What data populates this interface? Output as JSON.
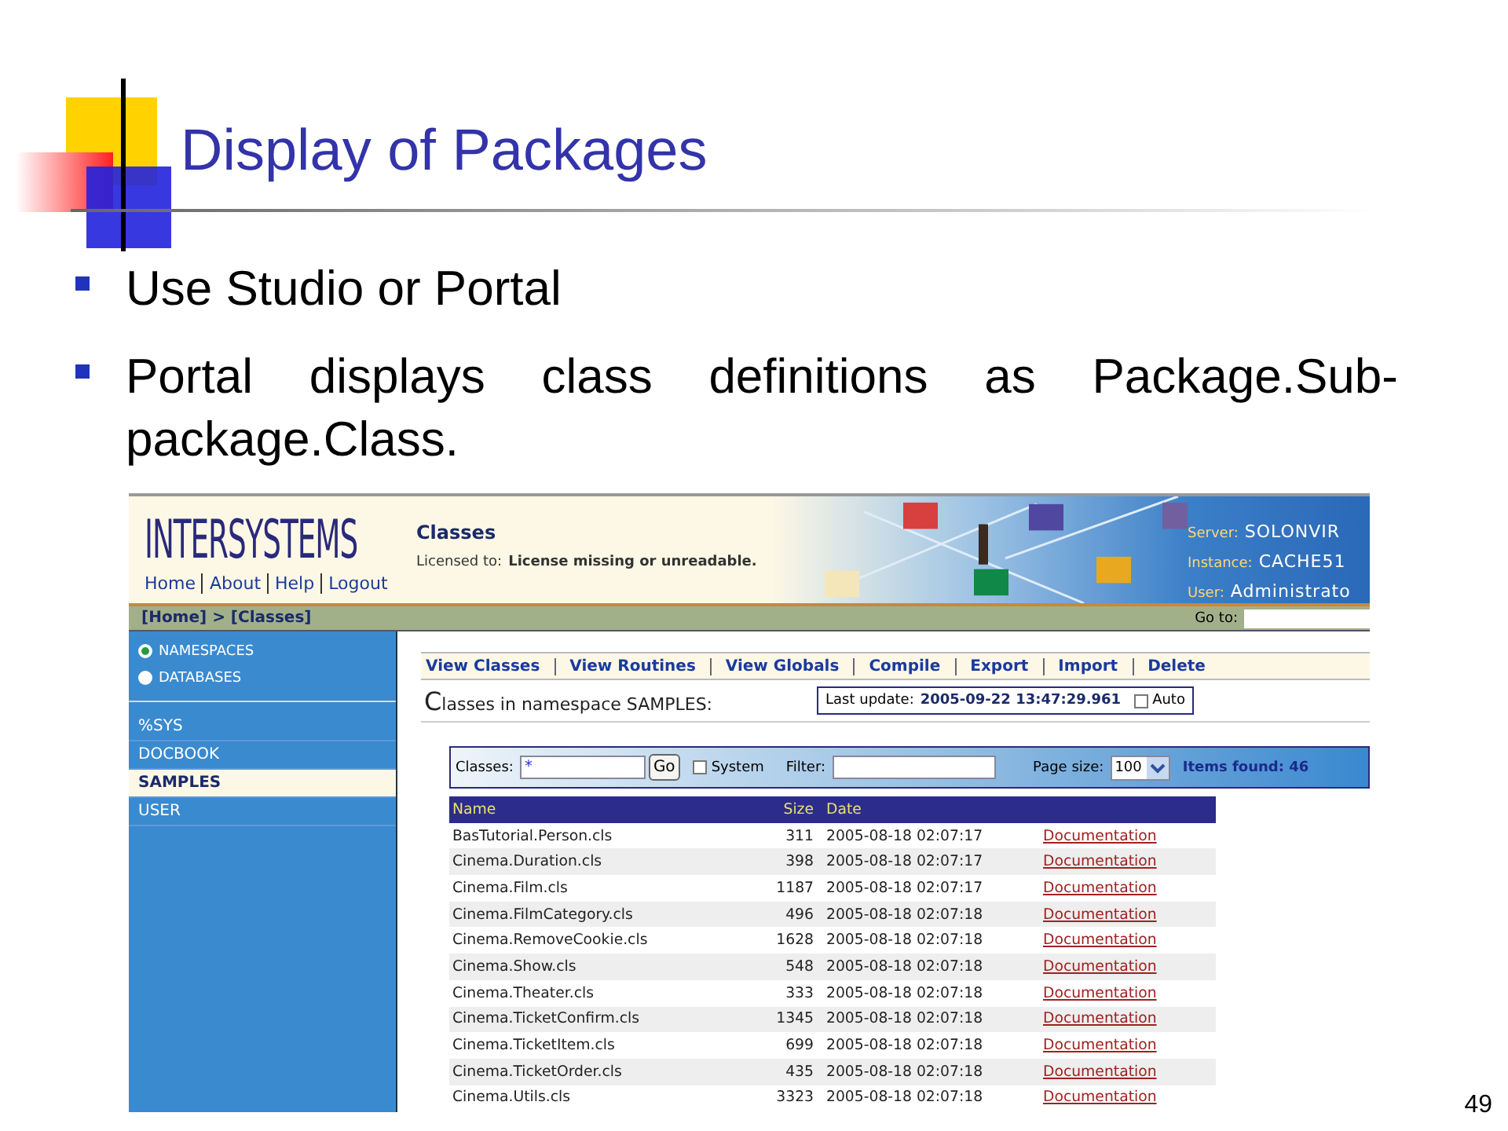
{
  "slide": {
    "title": "Display of Packages",
    "bullets": [
      "Use Studio or Portal",
      "Portal displays class definitions as Package.Sub-package.Class."
    ],
    "page_number": "49"
  },
  "portal": {
    "logo": "INTERSYSTEMS",
    "header_links": [
      "Home",
      "About",
      "Help",
      "Logout"
    ],
    "page_title": "Classes",
    "license_label": "Licensed to:",
    "license_value": "License missing or unreadable.",
    "server_info": [
      {
        "label": "Server:",
        "value": "SOLONVIR"
      },
      {
        "label": "Instance:",
        "value": "CACHE51"
      },
      {
        "label": "User:",
        "value": "Administrato"
      }
    ],
    "breadcrumb": "[Home] > [Classes]",
    "goto_label": "Go to:",
    "sidebar": {
      "modes": [
        {
          "label": "NAMESPACES",
          "selected": true
        },
        {
          "label": "DATABASES",
          "selected": false
        }
      ],
      "items": [
        {
          "label": "%SYS",
          "selected": false
        },
        {
          "label": "DOCBOOK",
          "selected": false
        },
        {
          "label": "SAMPLES",
          "selected": true
        },
        {
          "label": "USER",
          "selected": false
        }
      ]
    },
    "actions": [
      "View Classes",
      "View Routines",
      "View Globals",
      "Compile",
      "Export",
      "Import",
      "Delete"
    ],
    "heading": "Classes in namespace SAMPLES:",
    "last_update": {
      "label": "Last update:",
      "value": "2005-09-22 13:47:29.961",
      "auto_label": "Auto",
      "auto_checked": false
    },
    "filter_bar": {
      "classes_label": "Classes:",
      "classes_value": "*",
      "go": "Go",
      "system_label": "System",
      "system_checked": false,
      "filter_label": "Filter:",
      "page_size_label": "Page size:",
      "page_size": "100",
      "items_found": "Items found: 46"
    },
    "table": {
      "columns": [
        "Name",
        "Size",
        "Date"
      ],
      "rows": [
        {
          "name": "BasTutorial.Person.cls",
          "size": "311",
          "date": "2005-08-18 02:07:17",
          "link": "Documentation"
        },
        {
          "name": "Cinema.Duration.cls",
          "size": "398",
          "date": "2005-08-18 02:07:17",
          "link": "Documentation"
        },
        {
          "name": "Cinema.Film.cls",
          "size": "1187",
          "date": "2005-08-18 02:07:17",
          "link": "Documentation"
        },
        {
          "name": "Cinema.FilmCategory.cls",
          "size": "496",
          "date": "2005-08-18 02:07:18",
          "link": "Documentation"
        },
        {
          "name": "Cinema.RemoveCookie.cls",
          "size": "1628",
          "date": "2005-08-18 02:07:18",
          "link": "Documentation"
        },
        {
          "name": "Cinema.Show.cls",
          "size": "548",
          "date": "2005-08-18 02:07:18",
          "link": "Documentation"
        },
        {
          "name": "Cinema.Theater.cls",
          "size": "333",
          "date": "2005-08-18 02:07:18",
          "link": "Documentation"
        },
        {
          "name": "Cinema.TicketConfirm.cls",
          "size": "1345",
          "date": "2005-08-18 02:07:18",
          "link": "Documentation"
        },
        {
          "name": "Cinema.TicketItem.cls",
          "size": "699",
          "date": "2005-08-18 02:07:18",
          "link": "Documentation"
        },
        {
          "name": "Cinema.TicketOrder.cls",
          "size": "435",
          "date": "2005-08-18 02:07:18",
          "link": "Documentation"
        },
        {
          "name": "Cinema.Utils.cls",
          "size": "3323",
          "date": "2005-08-18 02:07:18",
          "link": "Documentation"
        }
      ]
    }
  }
}
